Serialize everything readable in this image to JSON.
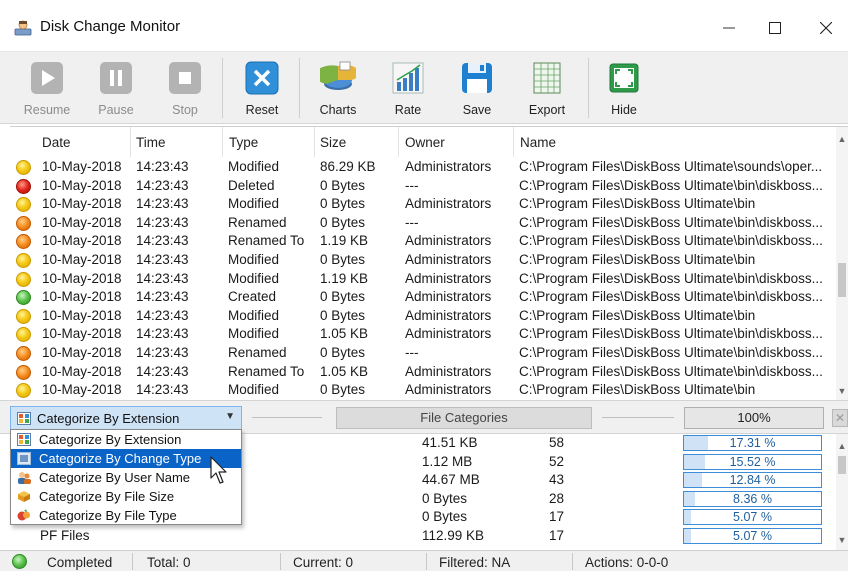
{
  "window": {
    "title": "Disk Change Monitor",
    "controls": {
      "minimize": "—",
      "maximize": "☐",
      "close": "✕"
    }
  },
  "toolbar": {
    "buttons": [
      {
        "label": "Resume",
        "icon": "play-icon",
        "enabled": false
      },
      {
        "label": "Pause",
        "icon": "pause-icon",
        "enabled": false
      },
      {
        "label": "Stop",
        "icon": "stop-icon",
        "enabled": false
      },
      {
        "label": "Reset",
        "icon": "reset-x-icon",
        "enabled": true
      },
      {
        "label": "Charts",
        "icon": "pie-chart-icon",
        "enabled": true
      },
      {
        "label": "Rate",
        "icon": "bar-chart-icon",
        "enabled": true
      },
      {
        "label": "Save",
        "icon": "floppy-disk-icon",
        "enabled": true
      },
      {
        "label": "Export",
        "icon": "spreadsheet-icon",
        "enabled": true
      },
      {
        "label": "Hide",
        "icon": "hide-window-icon",
        "enabled": true
      }
    ]
  },
  "table": {
    "columns": [
      "Date",
      "Time",
      "Type",
      "Size",
      "Owner",
      "Name"
    ],
    "rows": [
      {
        "status": "yellow",
        "date": "10-May-2018",
        "time": "14:23:43",
        "type": "Modified",
        "size": "86.29 KB",
        "owner": "Administrators",
        "name": "C:\\Program Files\\DiskBoss Ultimate\\sounds\\oper..."
      },
      {
        "status": "red",
        "date": "10-May-2018",
        "time": "14:23:43",
        "type": "Deleted",
        "size": "0 Bytes",
        "owner": "---",
        "name": "C:\\Program Files\\DiskBoss Ultimate\\bin\\diskboss..."
      },
      {
        "status": "yellow",
        "date": "10-May-2018",
        "time": "14:23:43",
        "type": "Modified",
        "size": "0 Bytes",
        "owner": "Administrators",
        "name": "C:\\Program Files\\DiskBoss Ultimate\\bin"
      },
      {
        "status": "orange",
        "date": "10-May-2018",
        "time": "14:23:43",
        "type": "Renamed",
        "size": "0 Bytes",
        "owner": "---",
        "name": "C:\\Program Files\\DiskBoss Ultimate\\bin\\diskboss..."
      },
      {
        "status": "orange",
        "date": "10-May-2018",
        "time": "14:23:43",
        "type": "Renamed To",
        "size": "1.19 KB",
        "owner": "Administrators",
        "name": "C:\\Program Files\\DiskBoss Ultimate\\bin\\diskboss..."
      },
      {
        "status": "yellow",
        "date": "10-May-2018",
        "time": "14:23:43",
        "type": "Modified",
        "size": "0 Bytes",
        "owner": "Administrators",
        "name": "C:\\Program Files\\DiskBoss Ultimate\\bin"
      },
      {
        "status": "yellow",
        "date": "10-May-2018",
        "time": "14:23:43",
        "type": "Modified",
        "size": "1.19 KB",
        "owner": "Administrators",
        "name": "C:\\Program Files\\DiskBoss Ultimate\\bin\\diskboss..."
      },
      {
        "status": "green",
        "date": "10-May-2018",
        "time": "14:23:43",
        "type": "Created",
        "size": "0 Bytes",
        "owner": "Administrators",
        "name": "C:\\Program Files\\DiskBoss Ultimate\\bin\\diskboss..."
      },
      {
        "status": "yellow",
        "date": "10-May-2018",
        "time": "14:23:43",
        "type": "Modified",
        "size": "0 Bytes",
        "owner": "Administrators",
        "name": "C:\\Program Files\\DiskBoss Ultimate\\bin"
      },
      {
        "status": "yellow",
        "date": "10-May-2018",
        "time": "14:23:43",
        "type": "Modified",
        "size": "1.05 KB",
        "owner": "Administrators",
        "name": "C:\\Program Files\\DiskBoss Ultimate\\bin\\diskboss..."
      },
      {
        "status": "orange",
        "date": "10-May-2018",
        "time": "14:23:43",
        "type": "Renamed",
        "size": "0 Bytes",
        "owner": "---",
        "name": "C:\\Program Files\\DiskBoss Ultimate\\bin\\diskboss..."
      },
      {
        "status": "orange",
        "date": "10-May-2018",
        "time": "14:23:43",
        "type": "Renamed To",
        "size": "1.05 KB",
        "owner": "Administrators",
        "name": "C:\\Program Files\\DiskBoss Ultimate\\bin\\diskboss..."
      },
      {
        "status": "yellow",
        "date": "10-May-2018",
        "time": "14:23:43",
        "type": "Modified",
        "size": "0 Bytes",
        "owner": "Administrators",
        "name": "C:\\Program Files\\DiskBoss Ultimate\\bin"
      }
    ]
  },
  "categories": {
    "combo_value": "Categorize By Extension",
    "header_label": "File Categories",
    "total_percent": "100%",
    "close_label": "✕",
    "dropdown_options": [
      {
        "label": "Categorize By Extension",
        "icon": "extension-grid-icon",
        "selected": false
      },
      {
        "label": "Categorize By Change Type",
        "icon": "change-type-icon",
        "selected": true
      },
      {
        "label": "Categorize By User Name",
        "icon": "user-icon",
        "selected": false
      },
      {
        "label": "Categorize By File Size",
        "icon": "file-size-icon",
        "selected": false
      },
      {
        "label": "Categorize By File Type",
        "icon": "file-type-icon",
        "selected": false
      }
    ],
    "rows": [
      {
        "name": "",
        "size": "41.51 KB",
        "count": "58",
        "percent": "17.31 %",
        "fraction": 0.1731
      },
      {
        "name": "",
        "size": "1.12 MB",
        "count": "52",
        "percent": "15.52 %",
        "fraction": 0.1552
      },
      {
        "name": "",
        "size": "44.67 MB",
        "count": "43",
        "percent": "12.84 %",
        "fraction": 0.1284
      },
      {
        "name": "",
        "size": "0 Bytes",
        "count": "28",
        "percent": "8.36 %",
        "fraction": 0.0836
      },
      {
        "name": "",
        "size": "0 Bytes",
        "count": "17",
        "percent": "5.07 %",
        "fraction": 0.0507
      },
      {
        "name": "PF Files",
        "size": "112.99 KB",
        "count": "17",
        "percent": "5.07 %",
        "fraction": 0.0507
      }
    ]
  },
  "statusbar": {
    "state": "Completed",
    "total": "Total: 0",
    "current": "Current: 0",
    "filtered": "Filtered: NA",
    "actions": "Actions: 0-0-0"
  }
}
